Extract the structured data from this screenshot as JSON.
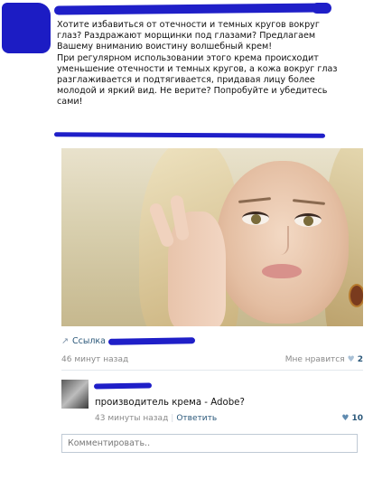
{
  "post": {
    "text": "Хотите избавиться от отечности и темных кругов вокруг\nглаз? Раздражают морщинки под глазами? Предлагаем\nВашему вниманию воистину волшебный крем!\nПри регулярном использовании этого крема происходит\nуменьшение отечности и темных кругов, а кожа вокруг глаз\nразглаживается и подтягивается, придавая лицу более\nмолодой и яркий вид. Не верите? Попробуйте и убедитесь\nсами!",
    "link_label": "Ссылка",
    "time": "46 минут назад",
    "like_label": "Мне нравится",
    "like_count": "2",
    "link_icon": "link-icon",
    "heart_icon": "heart-icon"
  },
  "comment": {
    "text": "производитель крема - Adobe?",
    "time": "43 минуты назад",
    "separator": "|",
    "reply_label": "Ответить",
    "like_count": "10"
  },
  "comment_box": {
    "placeholder": "Комментировать.."
  },
  "colors": {
    "scribble": "#1f1fc8",
    "link": "#2b587a",
    "meta": "#8a8a8a"
  }
}
